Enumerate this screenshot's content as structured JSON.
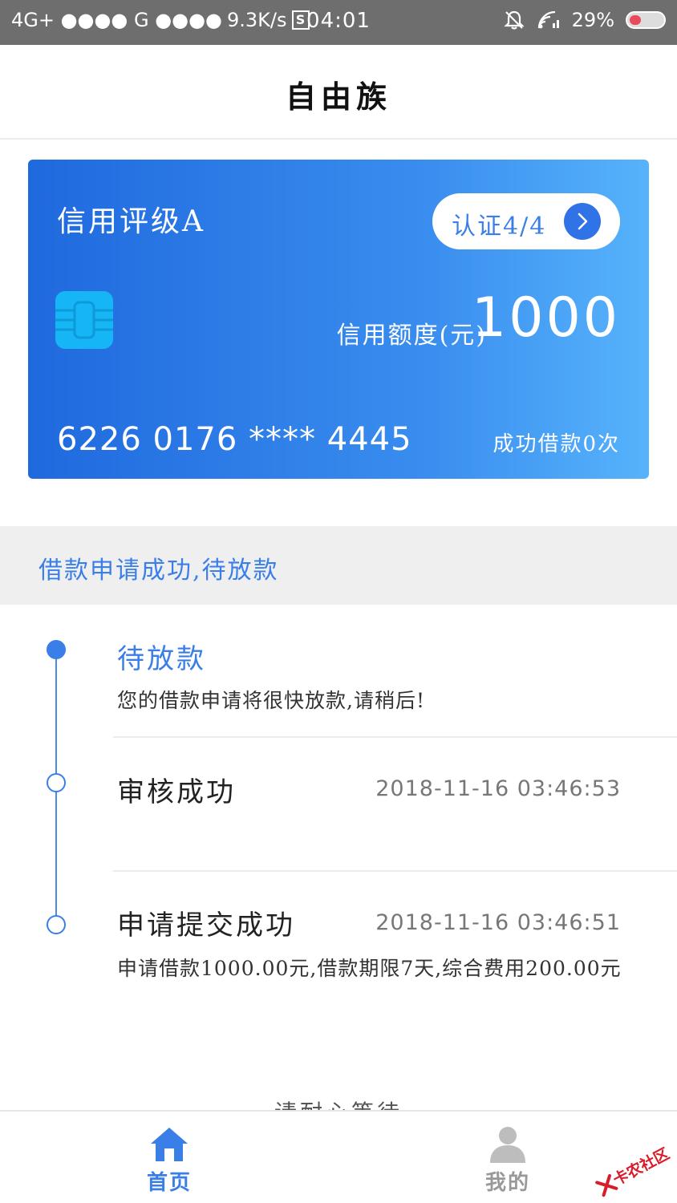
{
  "status_bar": {
    "network": "4G+ ●●●● G ●●●●",
    "speed": "9.3K/s",
    "s_icon": "S",
    "time": "04:01",
    "battery": "29%"
  },
  "nav": {
    "title": "自由族"
  },
  "card": {
    "rating": "信用评级A",
    "cert_label": "认证4/4",
    "limit_label": "信用额度(元)",
    "limit_value": "1000",
    "number": "6226 0176 **** 4445",
    "loan_count": "成功借款0次",
    "colors": {
      "gradient_start": "#1f69de",
      "gradient_end": "#57b3fb",
      "chip": "#16b5f5"
    }
  },
  "banner": {
    "text": "借款申请成功,待放款"
  },
  "timeline": [
    {
      "title": "待放款",
      "desc": "您的借款申请将很快放款,请稍后!",
      "time": "",
      "state": "current"
    },
    {
      "title": "审核成功",
      "desc": "",
      "time": "2018-11-16 03:46:53",
      "state": "done"
    },
    {
      "title": "申请提交成功",
      "desc": "申请借款1000.00元,借款期限7天,综合费用200.00元",
      "time": "2018-11-16 03:46:51",
      "state": "done"
    }
  ],
  "cut_text": "请耐心等待",
  "tabbar": {
    "home_label": "首页",
    "mine_label": "我的"
  },
  "watermark": {
    "text": "卡农社区"
  },
  "icons": [
    "s-icon",
    "mute-icon",
    "wifi-icon",
    "battery-icon",
    "chevron-right-icon",
    "chip-icon",
    "home-icon",
    "user-icon"
  ],
  "colors": {
    "accent": "#3a7ee8",
    "status_bar": "#6e6e6e",
    "banner_bg": "#efefef"
  }
}
